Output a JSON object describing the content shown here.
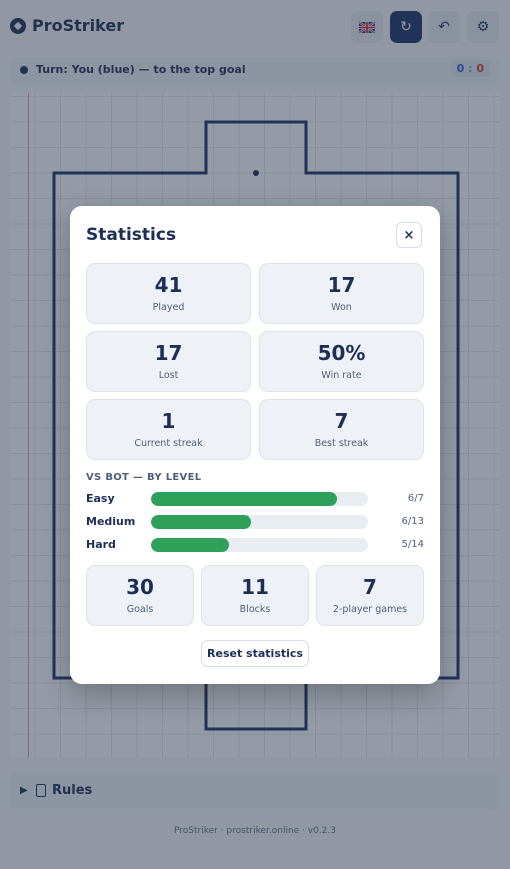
{
  "app": {
    "title": "ProStriker"
  },
  "header": {
    "language_icon": "uk-flag-icon",
    "restart_icon": "restart-icon",
    "undo_icon": "undo-icon",
    "settings_icon": "gear-icon"
  },
  "turn": {
    "text": "Turn: You (blue) — to the top goal",
    "score_you": "0",
    "score_sep": ":",
    "score_bot": "0"
  },
  "rules": {
    "label": "Rules"
  },
  "footer": {
    "text": "ProStriker · prostriker.online · v0.2.3"
  },
  "stats": {
    "title": "Statistics",
    "close": "×",
    "cards": [
      {
        "value": "41",
        "label": "Played"
      },
      {
        "value": "17",
        "label": "Won"
      },
      {
        "value": "17",
        "label": "Lost"
      },
      {
        "value": "50%",
        "label": "Win rate"
      },
      {
        "value": "1",
        "label": "Current streak"
      },
      {
        "value": "7",
        "label": "Best streak"
      }
    ],
    "levels_heading": "VS BOT — BY LEVEL",
    "levels": [
      {
        "name": "Easy",
        "won": 6,
        "total": 7,
        "fraction": "6/7"
      },
      {
        "name": "Medium",
        "won": 6,
        "total": 13,
        "fraction": "6/13"
      },
      {
        "name": "Hard",
        "won": 5,
        "total": 14,
        "fraction": "5/14"
      }
    ],
    "extra_cards": [
      {
        "value": "30",
        "label": "Goals"
      },
      {
        "value": "11",
        "label": "Blocks"
      },
      {
        "value": "7",
        "label": "2-player games"
      }
    ],
    "reset_label": "Reset statistics"
  },
  "colors": {
    "accent": "#1d3268",
    "bar": "#2ea05a",
    "you": "#2a5bd7"
  }
}
